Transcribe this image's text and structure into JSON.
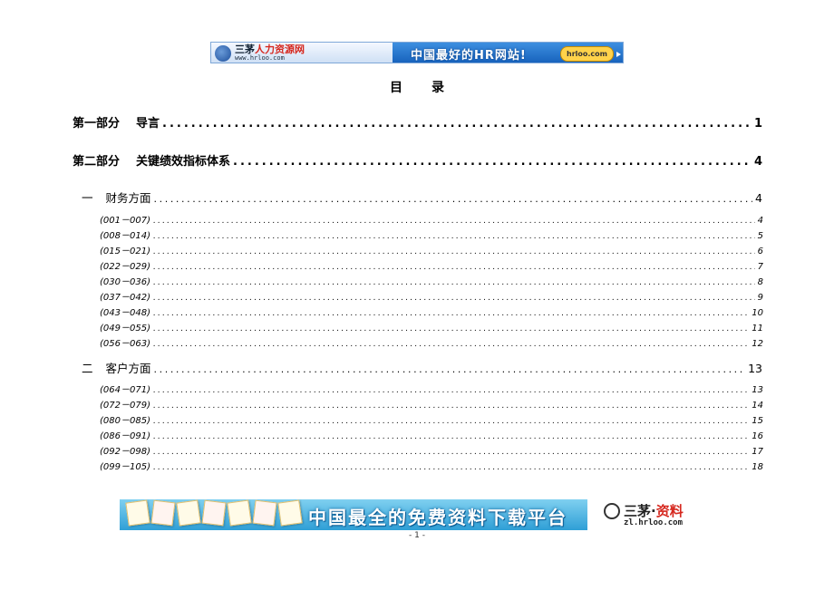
{
  "top_banner": {
    "brand_part1": "三茅",
    "brand_part2": "人力资源网",
    "brand_url": "www.hrloo.com",
    "slogan": "中国最好的HR网站!",
    "button_text": "hrloo.com"
  },
  "toc": {
    "title": "目录",
    "entries": [
      {
        "level": 1,
        "part": "第一部分",
        "title": "导言",
        "page": "1"
      },
      {
        "level": 1,
        "part": "第二部分",
        "title": "关键绩效指标体系",
        "page": "4"
      },
      {
        "level": 2,
        "part": "一",
        "title": "财务方面",
        "page": "4"
      },
      {
        "level": 3,
        "title": "(001－007)",
        "page": "4"
      },
      {
        "level": 3,
        "title": "(008－014)",
        "page": "5"
      },
      {
        "level": 3,
        "title": "(015－021)",
        "page": "6"
      },
      {
        "level": 3,
        "title": "(022－029)",
        "page": "7"
      },
      {
        "level": 3,
        "title": "(030－036)",
        "page": "8"
      },
      {
        "level": 3,
        "title": "(037－042)",
        "page": "9"
      },
      {
        "level": 3,
        "title": "(043－048)",
        "page": "10"
      },
      {
        "level": 3,
        "title": "(049－055)",
        "page": "11"
      },
      {
        "level": 3,
        "title": "(056－063)",
        "page": "12"
      },
      {
        "level": 2,
        "part": "二",
        "title": "客户方面",
        "page": "13"
      },
      {
        "level": 3,
        "title": "(064－071)",
        "page": "13"
      },
      {
        "level": 3,
        "title": "(072－079)",
        "page": "14"
      },
      {
        "level": 3,
        "title": "(080－085)",
        "page": "15"
      },
      {
        "level": 3,
        "title": "(086－091)",
        "page": "16"
      },
      {
        "level": 3,
        "title": "(092－098)",
        "page": "17"
      },
      {
        "level": 3,
        "title": "(099－105)",
        "page": "18"
      }
    ]
  },
  "bottom_banner": {
    "text": "中国最全的免费资料下载平台",
    "logo_part1": "三茅·",
    "logo_part2": "资料",
    "logo_url": "zl.hrloo.com"
  },
  "footer": {
    "page_number": "- 1 -"
  }
}
